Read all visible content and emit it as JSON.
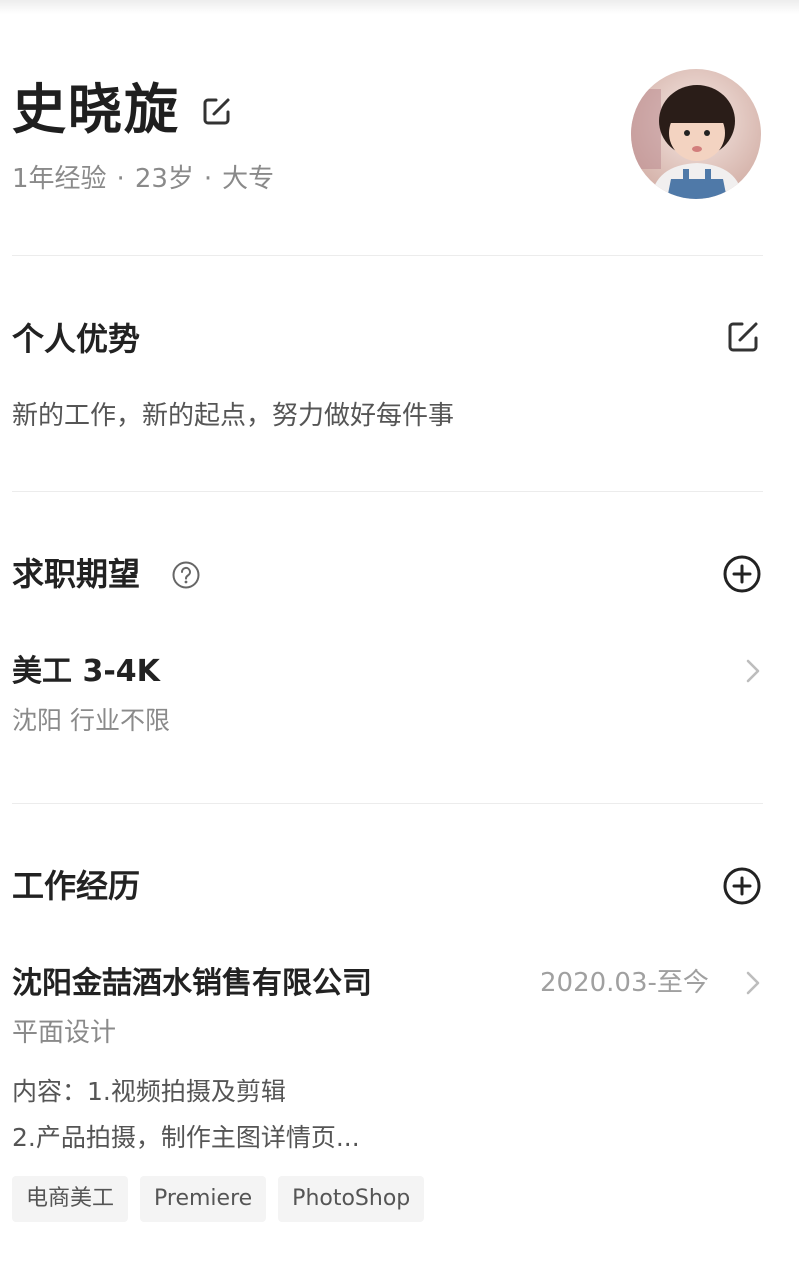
{
  "profile": {
    "name": "史晓旋",
    "experience": "1年经验",
    "age": "23岁",
    "education": "大专",
    "separator": "·"
  },
  "advantages": {
    "title": "个人优势",
    "text": "新的工作，新的起点，努力做好每件事"
  },
  "expectation": {
    "title": "求职期望",
    "job": "美工 3-4K",
    "detail": "沈阳 行业不限"
  },
  "work": {
    "title": "工作经历",
    "company": "沈阳金喆酒水销售有限公司",
    "date": "2020.03-至今",
    "position": "平面设计",
    "content_line1": "内容：1.视频拍摄及剪辑",
    "content_line2": "2.产品拍摄，制作主图详情页...",
    "tags": [
      "电商美工",
      "Premiere",
      "PhotoShop"
    ]
  },
  "icons": {
    "name_edit": "edit-icon",
    "advantages_edit": "edit-icon",
    "help": "question-circle-icon",
    "add": "plus-circle-icon",
    "chevron": "chevron-right-icon"
  },
  "colors": {
    "text_primary": "#222222",
    "text_secondary": "#8a8a8a",
    "divider": "#ececec",
    "tag_bg": "#f4f4f4"
  }
}
